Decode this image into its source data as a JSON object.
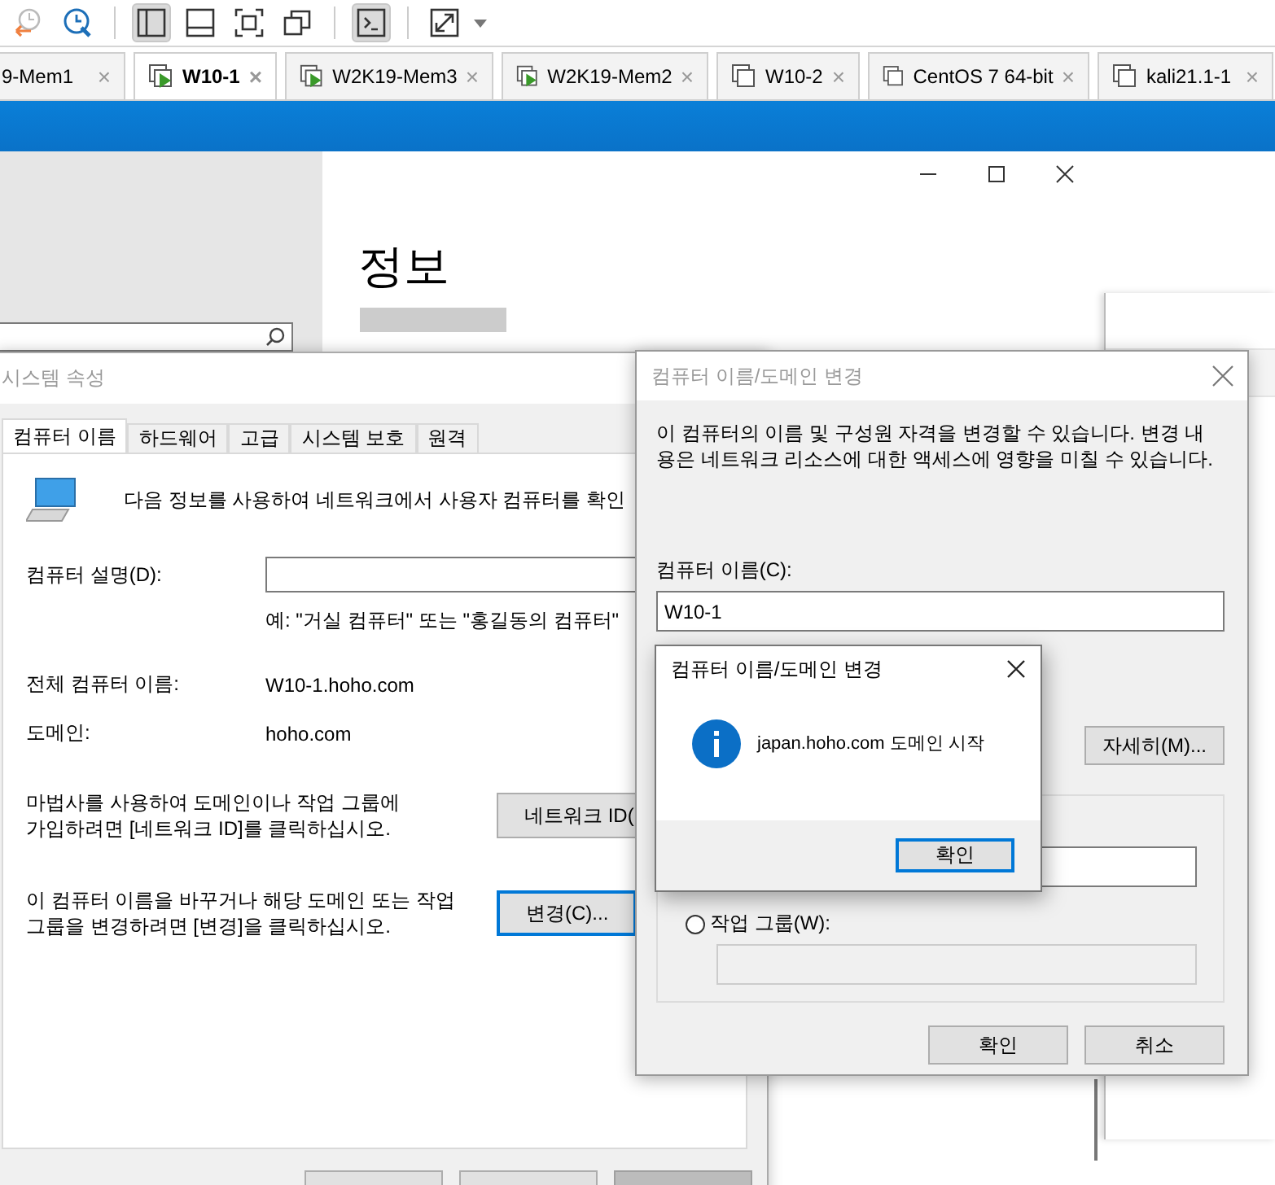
{
  "toolbar": [
    {
      "kind": "revert",
      "pressed": false
    },
    {
      "kind": "snapshot",
      "pressed": false
    },
    {
      "kind": "library",
      "pressed": true
    },
    {
      "kind": "single",
      "pressed": false
    },
    {
      "kind": "fullscreen",
      "pressed": false
    },
    {
      "kind": "unity",
      "pressed": false
    },
    {
      "kind": "console",
      "pressed": true
    },
    {
      "kind": "stretch",
      "pressed": false
    }
  ],
  "vm_tabs": [
    {
      "label": "9-Mem1",
      "selected": false,
      "close": "×"
    },
    {
      "label": "W10-1",
      "selected": true,
      "running": true,
      "close": "×"
    },
    {
      "label": "W2K19-Mem3",
      "selected": false,
      "running": true,
      "close": "×"
    },
    {
      "label": "W2K19-Mem2",
      "selected": false,
      "running": true,
      "close": "×"
    },
    {
      "label": "W10-2",
      "selected": false,
      "running": false,
      "close": "×"
    },
    {
      "label": "CentOS 7 64-bit",
      "selected": false,
      "running": false,
      "close": "×"
    },
    {
      "label": "kali21.1-1",
      "selected": false,
      "running": false,
      "close": "×"
    }
  ],
  "settings_window": {
    "heading": "정보"
  },
  "system_properties": {
    "title": "시스템 속성",
    "tabs": [
      {
        "label": "컴퓨터 이름",
        "selected": true
      },
      {
        "label": "하드웨어",
        "selected": false
      },
      {
        "label": "고급",
        "selected": false
      },
      {
        "label": "시스템 보호",
        "selected": false
      },
      {
        "label": "원격",
        "selected": false
      }
    ],
    "intro": "다음 정보를 사용하여 네트워크에서 사용자 컴퓨터를 확인",
    "description_label": "컴퓨터 설명(D):",
    "description_example": "예: \"거실 컴퓨터\" 또는 \"홍길동의 컴퓨터\"",
    "full_name_label": "전체 컴퓨터 이름:",
    "full_name": "W10-1.hoho.com",
    "domain_label": "도메인:",
    "domain": "hoho.com",
    "network_text": "마법사를 사용하여 도메인이나 작업 그룹에\n가입하려면 [네트워크 ID]를 클릭하십시오.",
    "network_button": "네트워크 ID(",
    "change_text": "이 컴퓨터 이름을 바꾸거나 해당 도메인 또는 작업\n그룹을 변경하려면 [변경]을 클릭하십시오.",
    "change_button": {
      "label": "변경(C)...",
      "focused": true
    },
    "bottom_buttons": [
      {
        "disabled": false
      },
      {
        "disabled": false
      },
      {
        "disabled": true
      }
    ]
  },
  "name_dialog": {
    "title": "컴퓨터 이름/도메인 변경",
    "info": "이 컴퓨터의 이름 및 구성원 자격을 변경할 수 있습니다. 변경 내\n용은 네트워크 리소스에 대한 액세스에 영향을 미칠 수 있습니다.",
    "name_label": "컴퓨터 이름(C):",
    "name_value": "W10-1",
    "details_button": "자세히(M)...",
    "workgroup": {
      "label": "작업 그룹(W):",
      "checked": false,
      "disabled": true
    },
    "ok": "확인",
    "cancel": "취소"
  },
  "message_box": {
    "title": "컴퓨터 이름/도메인 변경",
    "message": "japan.hoho.com 도메인 시작",
    "ok": "확인"
  }
}
